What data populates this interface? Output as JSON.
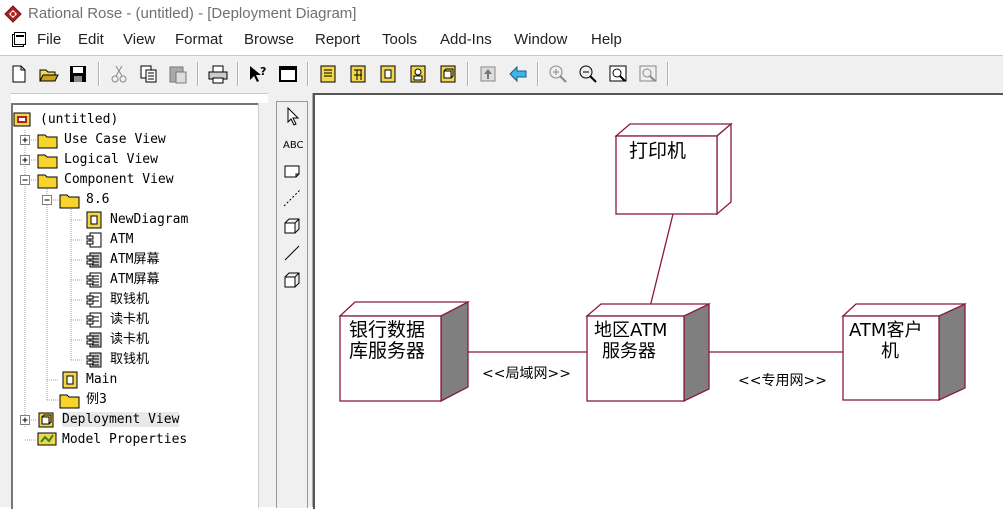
{
  "window": {
    "title": "Rational Rose - (untitled) - [Deployment Diagram]"
  },
  "menu": [
    "File",
    "Edit",
    "View",
    "Format",
    "Browse",
    "Report",
    "Tools",
    "Add-Ins",
    "Window",
    "Help"
  ],
  "toolbar": {
    "buttons": [
      "new-icon",
      "open-icon",
      "save-icon",
      "cut-icon",
      "copy-icon",
      "paste-icon",
      "print-icon",
      "context-help-icon",
      "view-doc-icon",
      "class-diagram-icon",
      "interaction-diagram-icon",
      "component-diagram-icon",
      "statechart-diagram-icon",
      "deployment-diagram-icon",
      "browse-parent-icon",
      "browse-previous-icon",
      "zoom-in-icon",
      "zoom-out-icon",
      "fit-in-window-icon",
      "undo-fit-icon"
    ]
  },
  "browser": {
    "root": "(untitled)",
    "use_case_view": "Use Case View",
    "logical_view": "Logical View",
    "component_view": "Component View",
    "package_86": "8.6",
    "items_86": [
      "NewDiagram",
      "ATM",
      "ATM屏幕",
      "ATM屏幕",
      "取钱机",
      "读卡机",
      "读卡机",
      "取钱机"
    ],
    "main": "Main",
    "package_li3": "例3",
    "deployment_view": "Deployment View",
    "model_properties": "Model Properties"
  },
  "toolbox": {
    "tools": [
      "selection-arrow-icon",
      "text-box-icon",
      "note-icon",
      "anchor-note-icon",
      "processor-icon",
      "connection-icon",
      "device-icon"
    ],
    "text_tool_label": "ABC"
  },
  "diagram": {
    "nodes": {
      "printer": "打印机",
      "bank_db_line1": "银行数据",
      "bank_db_line2": "库服务器",
      "regional_line1": "地区ATM",
      "regional_line2": "服务器",
      "client_line1": "ATM客户",
      "client_line2": "机"
    },
    "connections": {
      "lan": "<<局域网>>",
      "private": "<<专用网>>"
    },
    "colors": {
      "node_border": "#8b1a3a",
      "node_side": "#7f7f7f"
    }
  }
}
